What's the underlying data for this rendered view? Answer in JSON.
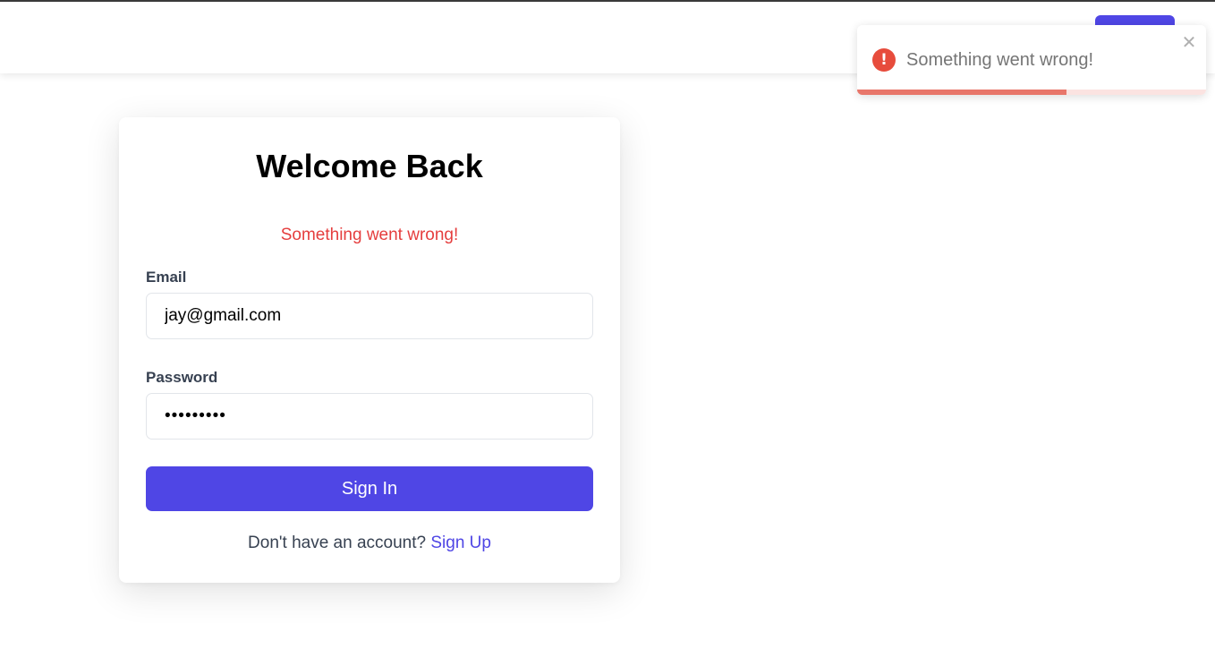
{
  "navbar": {
    "button_label": ""
  },
  "login_card": {
    "title": "Welcome Back",
    "error_message": "Something went wrong!",
    "email": {
      "label": "Email",
      "value": "jay@gmail.com"
    },
    "password": {
      "label": "Password",
      "value": "•••••••••"
    },
    "submit_label": "Sign In",
    "signup_prompt": "Don't have an account?",
    "signup_link": "Sign Up"
  },
  "toast": {
    "icon": "error-exclamation-icon",
    "message": "Something went wrong!",
    "close_icon": "close-icon",
    "progress": 0.6
  },
  "colors": {
    "accent": "#4f46e5",
    "error_text": "#e53e3e",
    "toast_error_icon": "#e74c3c",
    "toast_progress": "#e8766a"
  }
}
